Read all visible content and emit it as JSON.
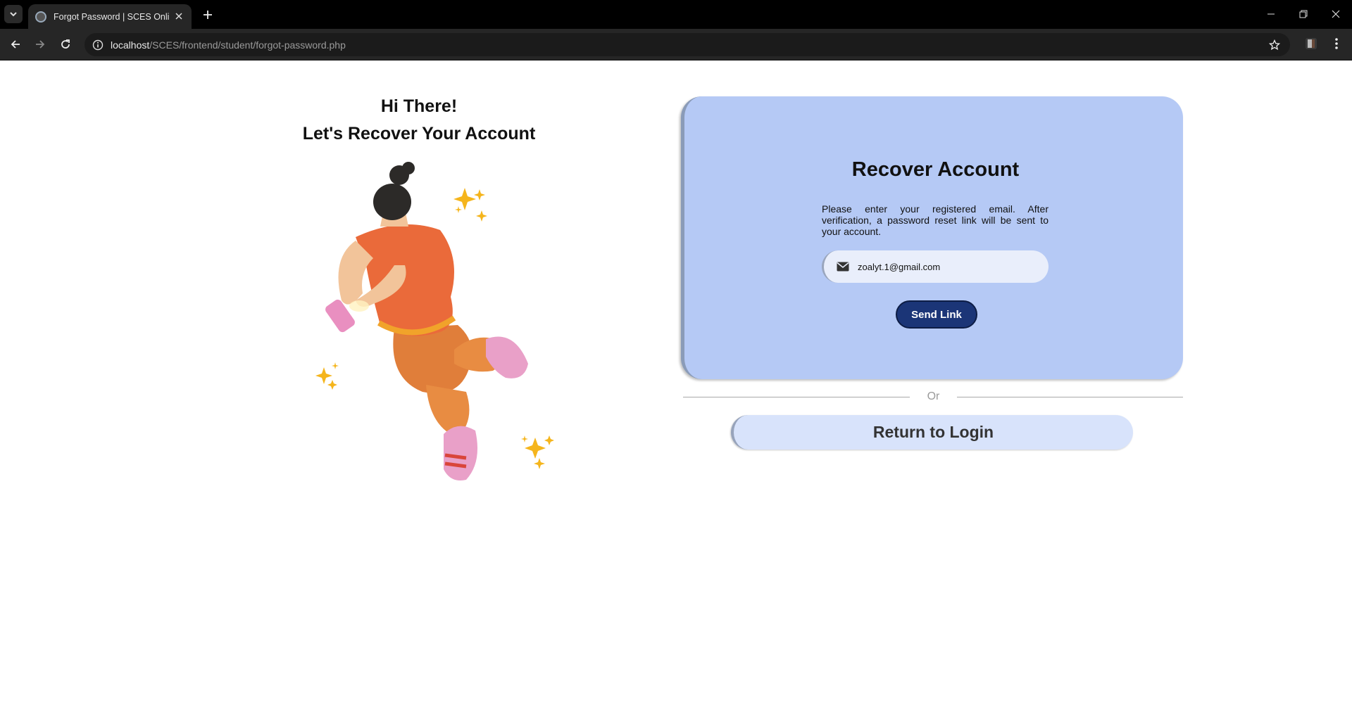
{
  "browser": {
    "tab_title": "Forgot Password | SCES Online",
    "url_host": "localhost",
    "url_path": "/SCES/frontend/student/forgot-password.php"
  },
  "left_panel": {
    "greeting_line1": "Hi There!",
    "greeting_line2": "Let's Recover Your Account",
    "illustration": "woman-jumping-with-phone-illustration"
  },
  "card": {
    "title": "Recover Account",
    "description": "Please enter your registered email. After verification, a password reset link will be sent to your account.",
    "email_value": "zoalyt.1@gmail.com",
    "send_label": "Send Link"
  },
  "divider_label": "Or",
  "return_label": "Return to Login",
  "colors": {
    "card_bg": "#b5c9f5",
    "button_bg": "#1b3577",
    "return_bg": "#d8e3fb"
  }
}
